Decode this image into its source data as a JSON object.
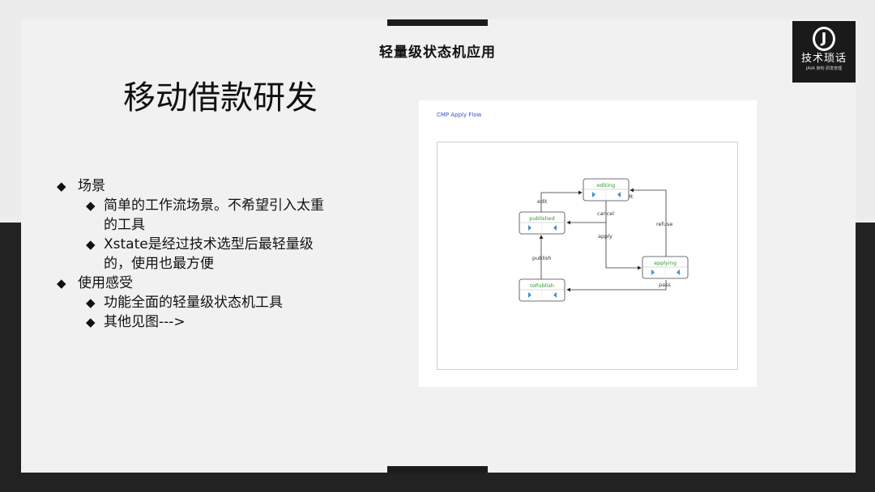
{
  "header": {
    "title": "轻量级状态机应用"
  },
  "logo": {
    "mark": "J",
    "name": "技术琐话",
    "sub": "JAVA 架构 研发管理"
  },
  "main": {
    "title": "移动借款研发",
    "bullets": [
      {
        "text": "场景",
        "children": [
          "简单的工作流场景。不希望引入太重的工具",
          "Xstate是经过技术选型后最轻量级的，使用也最方便"
        ]
      },
      {
        "text": "使用感受",
        "children": [
          "功能全面的轻量级状态机工具",
          "其他见图--->"
        ]
      }
    ]
  },
  "diagram": {
    "title": "CMP Apply Flow",
    "states": {
      "editing": "editing",
      "published": "published",
      "applying": "applying",
      "toPublish": "toPublish"
    },
    "edges": {
      "edit1": "edit",
      "edit2": "edit",
      "cancel": "cancel",
      "apply": "apply",
      "refuse": "refuse",
      "publish": "publish",
      "pass": "pass"
    },
    "colors": {
      "state_text": "#2e9b2e",
      "play_icon": "#3a8fd6",
      "title": "#3a4fd6"
    }
  }
}
